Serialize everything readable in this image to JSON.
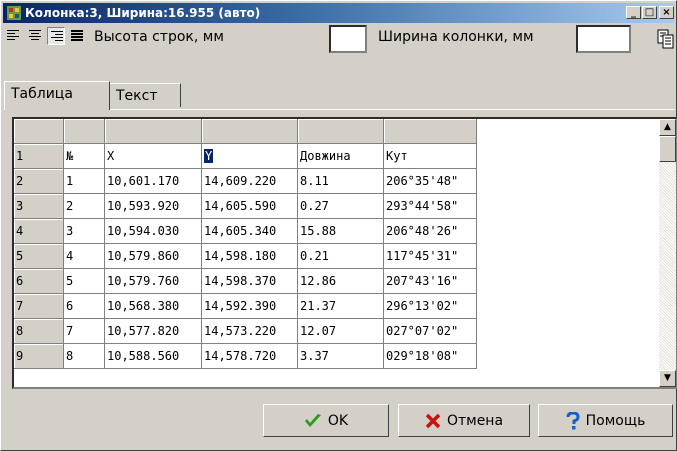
{
  "window": {
    "title": "Колонка:3, Ширина:16.955 (авто)",
    "controls": [
      "_",
      "□",
      "×"
    ]
  },
  "toolbar": {
    "row_height_label": "Высота строк, мм",
    "row_height_value": "",
    "col_width_label": "Ширина колонки, мм",
    "col_width_value": ""
  },
  "tabs": [
    {
      "label": "Таблица",
      "active": true
    },
    {
      "label": "Текст",
      "active": false
    }
  ],
  "grid": {
    "rows": [
      [
        "",
        "",
        "",
        "",
        "",
        ""
      ],
      [
        "1",
        "№",
        "X",
        "Y",
        "Довжина",
        "Кут"
      ],
      [
        "2",
        "1",
        "10,601.170",
        "14,609.220",
        "8.11",
        "206°35'48\""
      ],
      [
        "3",
        "2",
        "10,593.920",
        "14,605.590",
        "0.27",
        "293°44'58\""
      ],
      [
        "4",
        "3",
        "10,594.030",
        "14,605.340",
        "15.88",
        "206°48'26\""
      ],
      [
        "5",
        "4",
        "10,579.860",
        "14,598.180",
        "0.21",
        "117°45'31\""
      ],
      [
        "6",
        "5",
        "10,579.760",
        "14,598.370",
        "12.86",
        "207°43'16\""
      ],
      [
        "7",
        "6",
        "10,568.380",
        "14,592.390",
        "21.37",
        "296°13'02\""
      ],
      [
        "8",
        "7",
        "10,577.820",
        "14,573.220",
        "12.07",
        "027°07'02\""
      ],
      [
        "9",
        "8",
        "10,588.560",
        "14,578.720",
        "3.37",
        "029°18'08\""
      ]
    ]
  },
  "buttons": {
    "ok": "OK",
    "cancel": "Отмена",
    "help": "Помощь"
  }
}
